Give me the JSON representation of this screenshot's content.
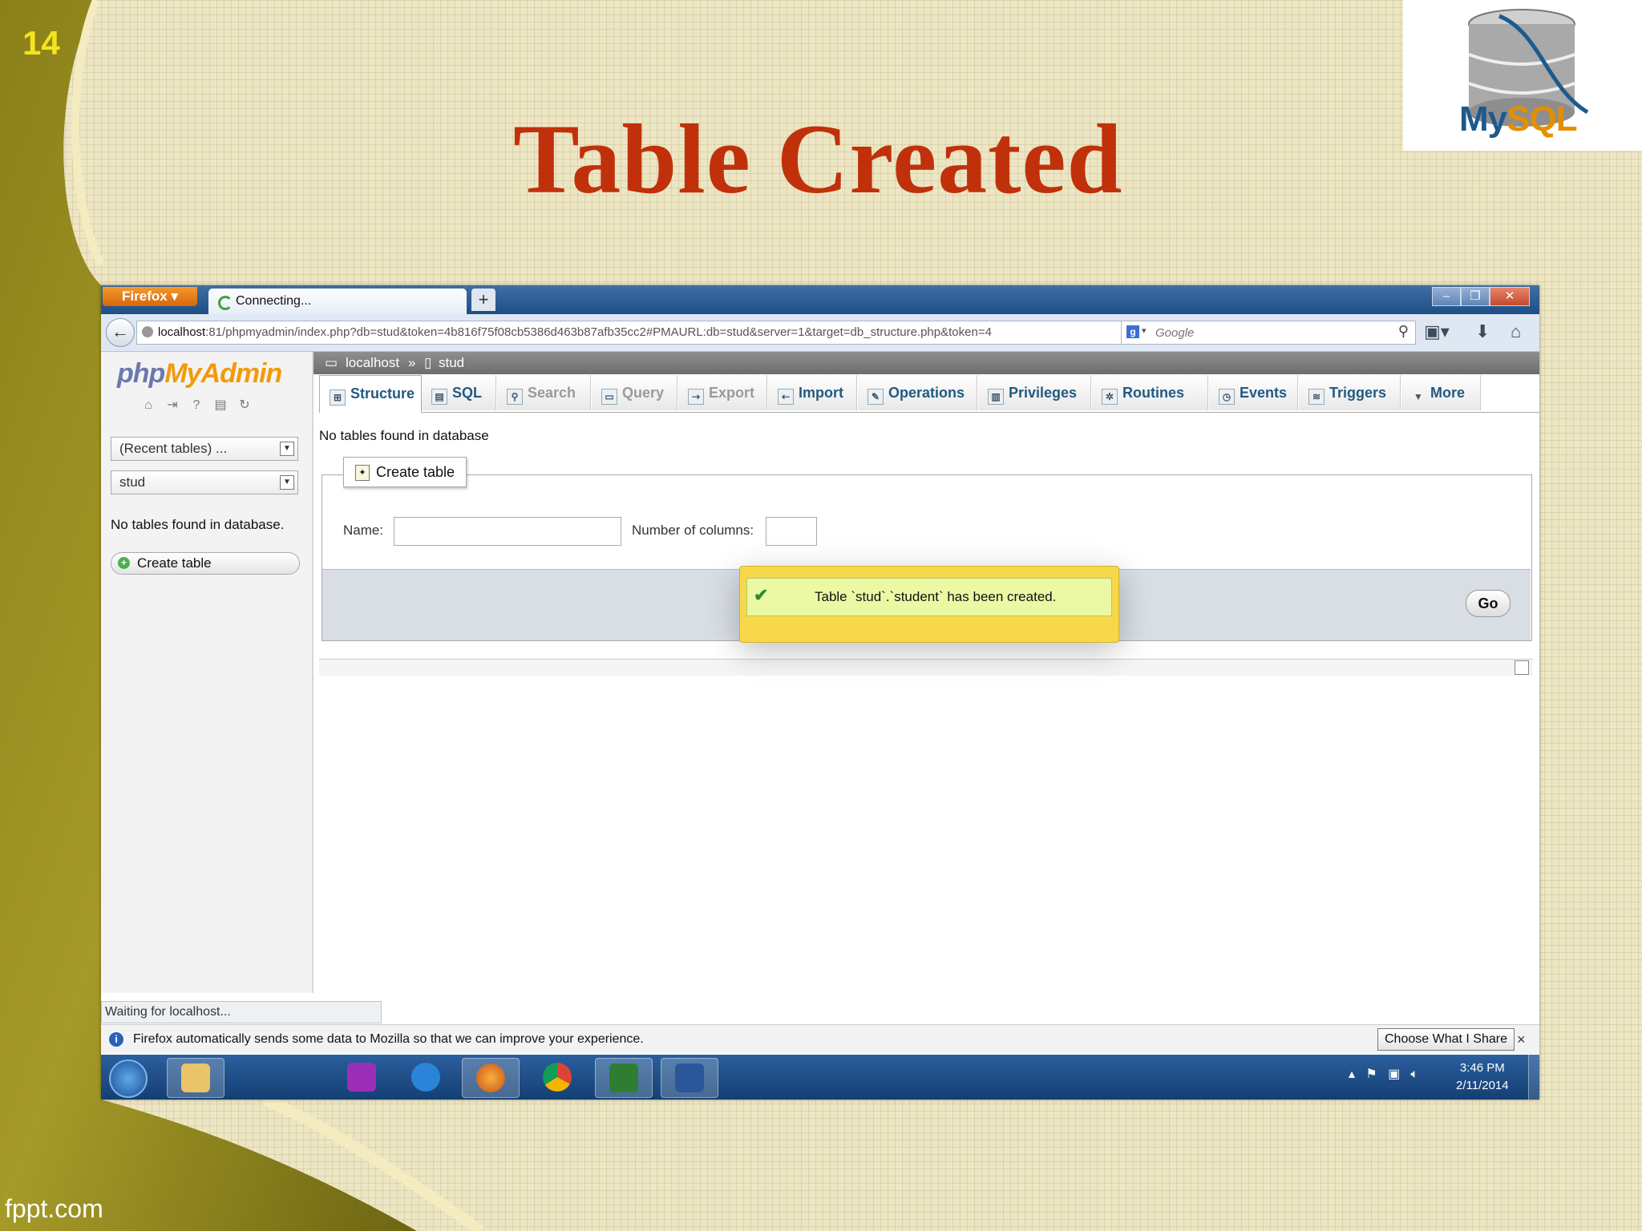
{
  "slide": {
    "number": "14",
    "title": "Table Created",
    "footer": "fppt.com",
    "logo_text_a": "My",
    "logo_text_b": "SQL"
  },
  "browser": {
    "menu_button": "Firefox ▾",
    "tab_label": "Connecting...",
    "new_tab": "+",
    "window_controls": [
      "–",
      "❐",
      "✕"
    ],
    "back_icon": "back-arrow-icon",
    "url_host": "localhost",
    "url_rest": ":81/phpmyadmin/index.php?db=stud&token=4b816f75f08cb5386d463b87afb35cc2#PMAURL:db=stud&server=1&target=db_structure.php&token=4",
    "search_placeholder": "Google",
    "status_text": "Waiting for localhost...",
    "infobar_text": "Firefox automatically sends some data to Mozilla so that we can improve your experience.",
    "infobar_button": "Choose What I Share",
    "infobar_close": "×"
  },
  "pma": {
    "logo_a": "php",
    "logo_b": "MyAdmin",
    "recent_tables": "(Recent tables) ...",
    "db_select": "stud",
    "sidebar_msg": "No tables found in database.",
    "sidebar_create": "Create table",
    "breadcrumb_server": "localhost",
    "breadcrumb_sep": "»",
    "breadcrumb_db": "stud",
    "tabs": [
      {
        "label": "Structure",
        "state": "active"
      },
      {
        "label": "SQL",
        "state": "normal"
      },
      {
        "label": "Search",
        "state": "disabled"
      },
      {
        "label": "Query",
        "state": "disabled"
      },
      {
        "label": "Export",
        "state": "disabled"
      },
      {
        "label": "Import",
        "state": "normal"
      },
      {
        "label": "Operations",
        "state": "normal"
      },
      {
        "label": "Privileges",
        "state": "normal"
      },
      {
        "label": "Routines",
        "state": "normal"
      },
      {
        "label": "Events",
        "state": "normal"
      },
      {
        "label": "Triggers",
        "state": "normal"
      },
      {
        "label": "More",
        "state": "normal"
      }
    ],
    "main_msg": "No tables found in database",
    "create_legend": "Create table",
    "name_label": "Name:",
    "name_value": "",
    "columns_label": "Number of columns:",
    "columns_value": "",
    "go_button": "Go",
    "notification": "Table `stud`.`student` has been created."
  },
  "taskbar": {
    "time": "3:46 PM",
    "date": "2/11/2014",
    "apps": [
      "explorer",
      "app-wand",
      "internet-explorer",
      "firefox",
      "chrome",
      "project",
      "word"
    ],
    "active_app": "firefox"
  }
}
